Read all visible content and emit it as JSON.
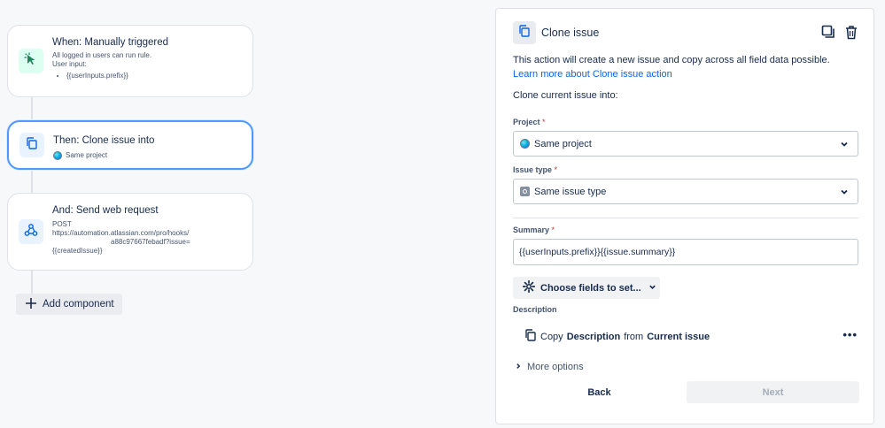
{
  "flow": {
    "trigger": {
      "title": "When: Manually triggered",
      "line1": "All logged in users can run rule.",
      "line2": "User input:",
      "bullet": "{{userInputs.prefix}}",
      "icon": "cursor-click-icon"
    },
    "action": {
      "title": "Then: Clone issue into",
      "detail": "Same project",
      "icon": "copy-icon"
    },
    "webhook": {
      "title": "And: Send web request",
      "method": "POST",
      "url_line1": "https://automation.atlassian.com/pro/hooks/",
      "url_line2": "a88c97667febadf?issue=",
      "url_line3": "{{createdIssue}}",
      "icon": "webhook-icon"
    },
    "add_component_label": "Add component"
  },
  "panel": {
    "title": "Clone issue",
    "description": "This action will create a new issue and copy across all field data possible.",
    "learn_more": "Learn more about Clone issue action",
    "clone_into_label": "Clone current issue into:",
    "project": {
      "label": "Project",
      "value": "Same project"
    },
    "issue_type": {
      "label": "Issue type",
      "value": "Same issue type"
    },
    "summary": {
      "label": "Summary",
      "value": "{{userInputs.prefix}}{{issue.summary}}"
    },
    "choose_fields_label": "Choose fields to set...",
    "description_section": {
      "label": "Description",
      "copy_word": "Copy",
      "field": "Description",
      "from_word": "from",
      "source": "Current issue"
    },
    "more_options_label": "More options",
    "back_label": "Back",
    "next_label": "Next",
    "required_marker": "*"
  },
  "colors": {
    "accent": "#0c66e4",
    "selected_border": "#4c9aff",
    "trigger_icon_bg": "#dcfff1",
    "trigger_icon": "#1f845a",
    "action_icon_bg": "#e9f2ff",
    "action_icon": "#0c66e4"
  }
}
